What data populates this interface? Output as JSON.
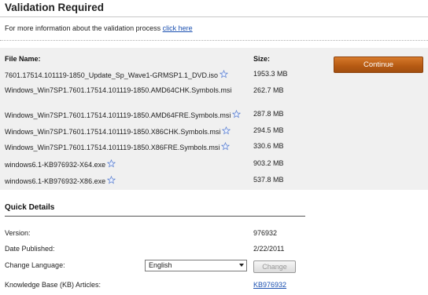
{
  "header": {
    "title": "Validation Required",
    "info_text": "For more information about the validation process ",
    "info_link": "click here"
  },
  "files": {
    "name_header": "File Name:",
    "size_header": "Size:",
    "continue_label": "Continue",
    "rows": [
      {
        "name": "7601.17514.101119-1850_Update_Sp_Wave1-GRMSP1.1_DVD.iso",
        "size": "1953.3 MB"
      },
      {
        "name": "Windows_Win7SP1.7601.17514.101119-1850.AMD64CHK.Symbols.msi",
        "size": "262.7 MB"
      },
      {
        "name": "Windows_Win7SP1.7601.17514.101119-1850.AMD64FRE.Symbols.msi",
        "size": "287.8 MB"
      },
      {
        "name": "Windows_Win7SP1.7601.17514.101119-1850.X86CHK.Symbols.msi",
        "size": "294.5 MB"
      },
      {
        "name": "Windows_Win7SP1.7601.17514.101119-1850.X86FRE.Symbols.msi",
        "size": "330.6 MB"
      },
      {
        "name": "windows6.1-KB976932-X64.exe",
        "size": "903.2 MB"
      },
      {
        "name": "windows6.1-KB976932-X86.exe",
        "size": "537.8 MB"
      }
    ]
  },
  "quick_details": {
    "title": "Quick Details",
    "version_label": "Version:",
    "version_value": "976932",
    "date_label": "Date Published:",
    "date_value": "2/22/2011",
    "language_label": "Change Language:",
    "language_selected": "English",
    "change_button": "Change",
    "kb_label": "Knowledge Base (KB) Articles:",
    "kb_value": "KB976932"
  },
  "colors": {
    "continue_button": "#b85c14",
    "link": "#1a4fb0",
    "panel_background": "#f0f0f0"
  },
  "icons": {
    "file_row_icon": "star-icon"
  }
}
